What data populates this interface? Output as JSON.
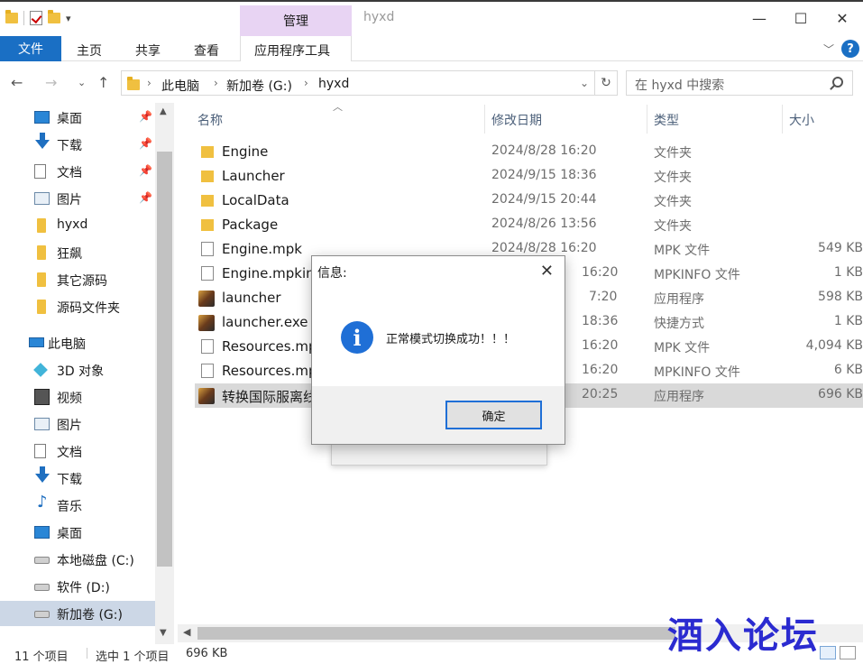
{
  "titlebar": {
    "window_title": "hyxd",
    "context_tab_group": "管理",
    "minimize": "—",
    "maximize": "☐",
    "close": "✕"
  },
  "ribbon": {
    "tabs": [
      "文件",
      "主页",
      "共享",
      "查看",
      "应用程序工具"
    ],
    "help": "?"
  },
  "address": {
    "crumbs": [
      "此电脑",
      "新加卷 (G:)",
      "hyxd"
    ],
    "search_placeholder": "在 hyxd 中搜索"
  },
  "nav": {
    "items": [
      {
        "label": "桌面",
        "icon": "desktop-icon",
        "pinned": true
      },
      {
        "label": "下载",
        "icon": "download-icon",
        "pinned": true
      },
      {
        "label": "文档",
        "icon": "document-icon",
        "pinned": true
      },
      {
        "label": "图片",
        "icon": "pictures-icon",
        "pinned": true
      },
      {
        "label": "hyxd",
        "icon": "folder-icon",
        "pinned": false
      },
      {
        "label": "狂飙",
        "icon": "folder-icon",
        "pinned": false
      },
      {
        "label": "其它源码",
        "icon": "folder-icon",
        "pinned": false
      },
      {
        "label": "源码文件夹",
        "icon": "folder-icon",
        "pinned": false
      },
      {
        "label": "此电脑",
        "icon": "pc-icon",
        "pinned": false
      },
      {
        "label": "3D 对象",
        "icon": "3d-objects-icon",
        "pinned": false
      },
      {
        "label": "视频",
        "icon": "video-icon",
        "pinned": false
      },
      {
        "label": "图片",
        "icon": "pictures-icon",
        "pinned": false
      },
      {
        "label": "文档",
        "icon": "document-icon",
        "pinned": false
      },
      {
        "label": "下载",
        "icon": "download-icon",
        "pinned": false
      },
      {
        "label": "音乐",
        "icon": "music-icon",
        "pinned": false
      },
      {
        "label": "桌面",
        "icon": "desktop-icon",
        "pinned": false
      },
      {
        "label": "本地磁盘 (C:)",
        "icon": "drive-icon",
        "pinned": false
      },
      {
        "label": "软件 (D:)",
        "icon": "drive-icon",
        "pinned": false
      },
      {
        "label": "新加卷 (G:)",
        "icon": "drive-icon",
        "pinned": false
      }
    ]
  },
  "filelist": {
    "columns": [
      "名称",
      "修改日期",
      "类型",
      "大小"
    ],
    "rows": [
      {
        "name": "Engine",
        "date": "2024/8/28 16:20",
        "type": "文件夹",
        "size": "",
        "icon": "folder-icon"
      },
      {
        "name": "Launcher",
        "date": "2024/9/15 18:36",
        "type": "文件夹",
        "size": "",
        "icon": "folder-icon"
      },
      {
        "name": "LocalData",
        "date": "2024/9/15 20:44",
        "type": "文件夹",
        "size": "",
        "icon": "folder-icon"
      },
      {
        "name": "Package",
        "date": "2024/8/26 13:56",
        "type": "文件夹",
        "size": "",
        "icon": "folder-icon"
      },
      {
        "name": "Engine.mpk",
        "date": "2024/8/28 16:20",
        "type": "MPK 文件",
        "size": "549 KB",
        "icon": "file-icon"
      },
      {
        "name": "Engine.mpkinf",
        "date": "16:20",
        "type": "MPKINFO 文件",
        "size": "1 KB",
        "icon": "file-icon"
      },
      {
        "name": "launcher",
        "date": "7:20",
        "type": "应用程序",
        "size": "598 KB",
        "icon": "app-icon"
      },
      {
        "name": "launcher.exe",
        "date": "18:36",
        "type": "快捷方式",
        "size": "1 KB",
        "icon": "shortcut-icon"
      },
      {
        "name": "Resources.mp",
        "date": "16:20",
        "type": "MPK 文件",
        "size": "4,094 KB",
        "icon": "file-icon"
      },
      {
        "name": "Resources.mp",
        "date": "16:20",
        "type": "MPKINFO 文件",
        "size": "6 KB",
        "icon": "file-icon"
      },
      {
        "name": "转换国际服离线",
        "date": "20:25",
        "type": "应用程序",
        "size": "696 KB",
        "icon": "app-icon",
        "selected": true
      }
    ]
  },
  "status": {
    "count": "11 个项目",
    "selection": "选中 1 个项目",
    "size": "696 KB"
  },
  "dialog": {
    "title": "信息:",
    "message": "正常模式切换成功！！！",
    "ok": "确定",
    "close": "✕",
    "icon": "info-icon"
  },
  "watermark": "酒入论坛"
}
